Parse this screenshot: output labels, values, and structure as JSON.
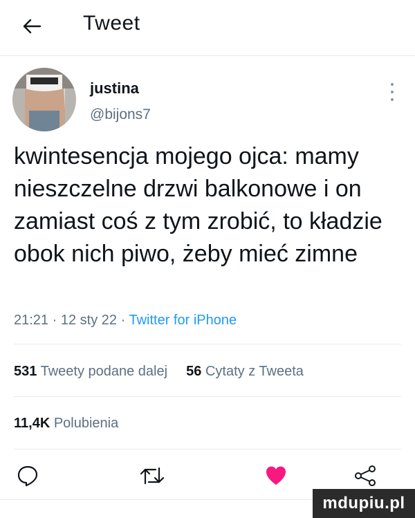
{
  "header": {
    "title": "Tweet"
  },
  "author": {
    "display_name": "justina",
    "handle": "@bijons7"
  },
  "tweet": {
    "text": "kwintesencja mojego ojca: mamy nieszczelne drzwi balkonowe i on zamiast coś z tym zrobić, to kładzie obok nich piwo, żeby mieć zimne",
    "time": "21:21",
    "date": "12 sty 22",
    "separator": "·",
    "source": "Twitter for iPhone"
  },
  "stats": {
    "retweets_count": "531",
    "retweets_label": "Tweety podane dalej",
    "quotes_count": "56",
    "quotes_label": "Cytaty z Tweeta",
    "likes_count": "11,4K",
    "likes_label": "Polubienia"
  },
  "actions": {
    "reply_icon": "comment-icon",
    "retweet_icon": "retweet-icon",
    "like_icon": "heart-filled-icon",
    "share_icon": "share-icon",
    "liked": true
  },
  "watermark": "mdupiu.pl",
  "colors": {
    "text": "#0f1419",
    "secondary": "#5b7083",
    "link": "#1d9bf0",
    "like": "#f91880",
    "divider": "#e6e9ec"
  }
}
